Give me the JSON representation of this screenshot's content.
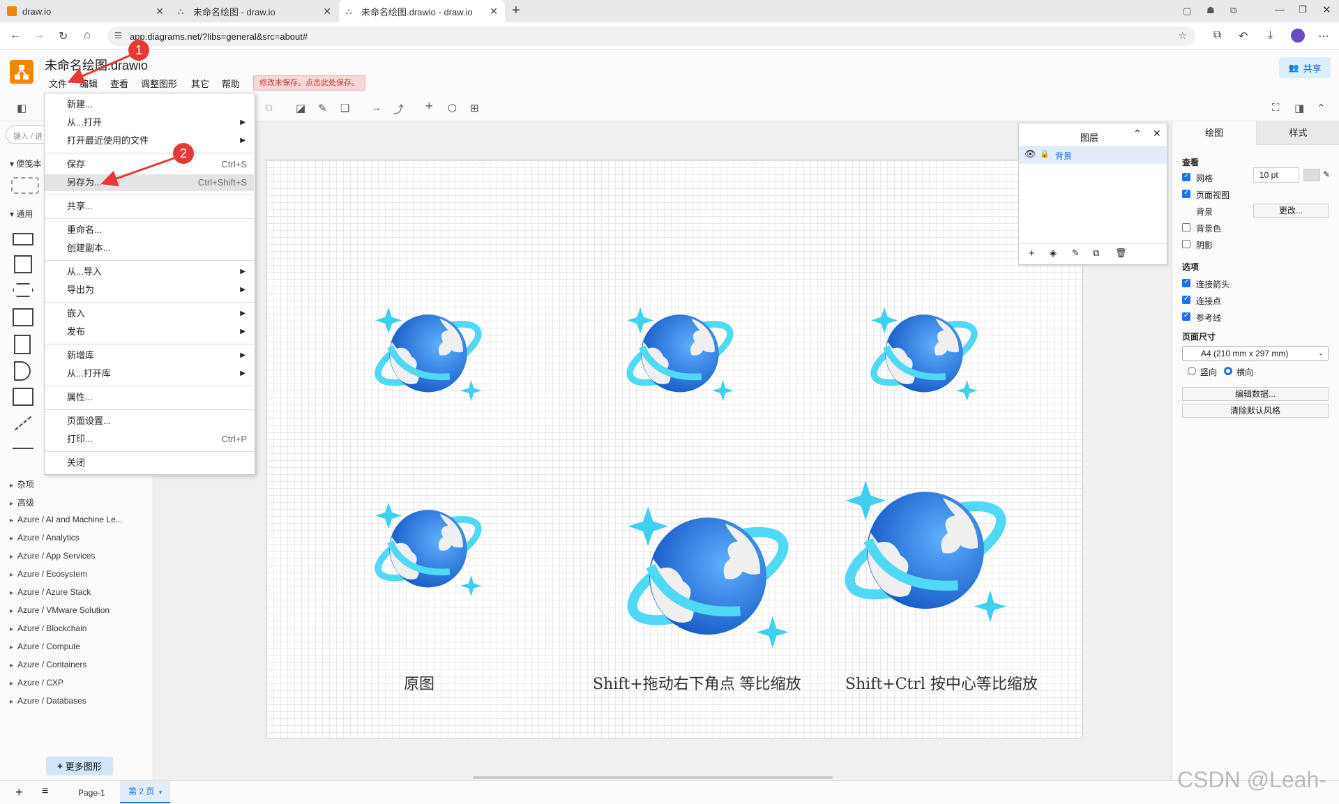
{
  "browser": {
    "tabs": [
      {
        "label": "draw.io"
      },
      {
        "label": "未命名绘图 - draw.io"
      },
      {
        "label": "未命名绘图.drawio - draw.io"
      }
    ],
    "url": "app.diagrams.net/?libs=general&src=about#"
  },
  "app": {
    "title": "未命名绘图.drawio",
    "menus": [
      "文件",
      "编辑",
      "查看",
      "调整图形",
      "其它",
      "帮助"
    ],
    "unsaved_notice": "修改未保存。点击此处保存。",
    "share_label": "共享"
  },
  "file_menu": {
    "items": [
      {
        "label": "新建..."
      },
      {
        "label": "从...打开"
      },
      {
        "label": "打开最近使用的文件"
      },
      {
        "label": "保存",
        "shortcut": "Ctrl+S"
      },
      {
        "label": "另存为...",
        "shortcut": "Ctrl+Shift+S"
      },
      {
        "label": "共享..."
      },
      {
        "label": "重命名..."
      },
      {
        "label": "创建副本..."
      },
      {
        "label": "从...导入"
      },
      {
        "label": "导出为"
      },
      {
        "label": "嵌入"
      },
      {
        "label": "发布"
      },
      {
        "label": "新增库"
      },
      {
        "label": "从...打开库"
      },
      {
        "label": "属性..."
      },
      {
        "label": "页面设置..."
      },
      {
        "label": "打印...",
        "shortcut": "Ctrl+P"
      },
      {
        "label": "关闭"
      }
    ]
  },
  "annotations": [
    "1",
    "2"
  ],
  "left_panel": {
    "search_placeholder": "键入 / 进",
    "sections": [
      "便笺本",
      "通用",
      "杂项",
      "高级"
    ],
    "libraries": [
      "Azure / AI and Machine Le...",
      "Azure / Analytics",
      "Azure / App Services",
      "Azure / Ecosystem",
      "Azure / Azure Stack",
      "Azure / VMware Solution",
      "Azure / Blockchain",
      "Azure / Compute",
      "Azure / Containers",
      "Azure / CXP",
      "Azure / Databases"
    ],
    "more_shapes": "更多图形"
  },
  "canvas": {
    "captions": [
      "原图",
      "Shift+拖动右下角点 等比缩放",
      "Shift+Ctrl 按中心等比缩放"
    ]
  },
  "layers": {
    "title": "图层",
    "layer_name": "背景"
  },
  "right_panel": {
    "tabs": [
      "绘图",
      "样式"
    ],
    "view_header": "查看",
    "grid_label": "网格",
    "grid_size": "10 pt",
    "page_view_label": "页面视图",
    "background_label": "背景",
    "change_button": "更改...",
    "bg_color_label": "背景色",
    "shadow_label": "阴影",
    "options_header": "选项",
    "connection_arrows": "连接箭头",
    "connection_points": "连接点",
    "guides": "参考线",
    "page_size_header": "页面尺寸",
    "page_size_value": "A4 (210 mm x 297 mm)",
    "portrait": "竖向",
    "landscape": "横向",
    "edit_data": "编辑数据...",
    "clear_style": "清除默认风格"
  },
  "bottom": {
    "pages": [
      "Page-1",
      "第 2 页"
    ]
  },
  "watermark": "CSDN @Leah-",
  "colors": {
    "accent": "#1a73e8",
    "logo": "#f08705",
    "planet_blue": "#1e6fd9",
    "ring_cyan": "#50d8f5",
    "annotation_red": "#e53935"
  }
}
